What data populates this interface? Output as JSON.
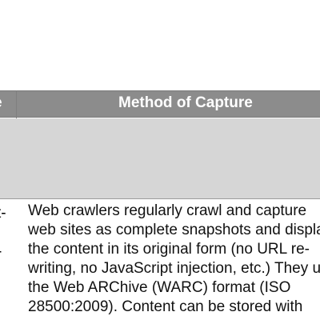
{
  "table": {
    "header_left_fragment": "e",
    "header_right": "Method of Capture",
    "left_cell_fragments": [
      "t-",
      "-"
    ],
    "body_lines": [
      "Web crawlers regularly crawl and capture",
      "web sites as complete snapshots and displa",
      "the content in its original form (no URL re-",
      "writing, no JavaScript injection, etc.) They u",
      "the Web ARChive (WARC) format (ISO",
      "28500:2009). Content can be stored with"
    ]
  }
}
